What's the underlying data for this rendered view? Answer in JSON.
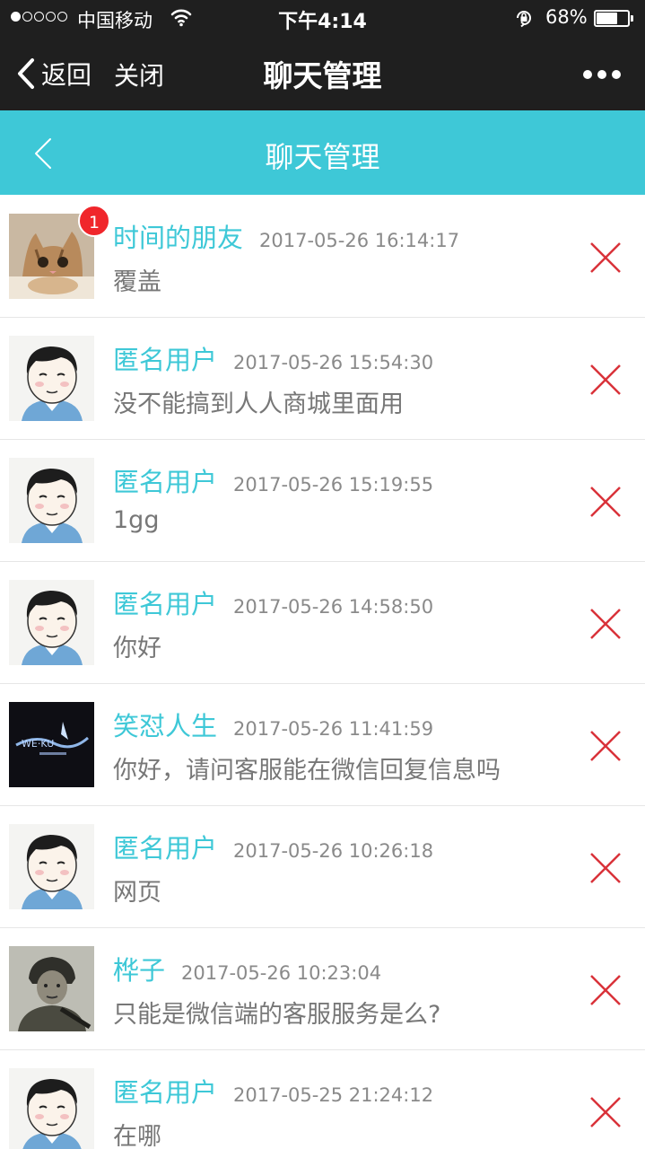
{
  "status_bar": {
    "carrier": "中国移动",
    "time": "下午4:14",
    "battery_percent": "68%",
    "battery_level": 0.68,
    "signal_bars": 1,
    "icons": [
      "signal-dots-icon",
      "wifi-icon",
      "rotation-lock-icon",
      "battery-icon"
    ]
  },
  "wechat_header": {
    "back_label": "返回",
    "close_label": "关闭",
    "title": "聊天管理",
    "more_icon": "more-dots-icon"
  },
  "app_header": {
    "title": "聊天管理",
    "back_icon": "chevron-left-icon"
  },
  "colors": {
    "accent": "#3ec8d7",
    "dark_bar": "#1f1f1f",
    "delete": "#d9323a",
    "badge": "#f0262b",
    "timestamp": "#8a8a8a",
    "message": "#777777"
  },
  "chats": [
    {
      "name": "时间的朋友",
      "time": "2017-05-26 16:14:17",
      "message": "覆盖",
      "avatar": "cat-photo",
      "badge": "1"
    },
    {
      "name": "匿名用户",
      "time": "2017-05-26 15:54:30",
      "message": "没不能搞到人人商城里面用",
      "avatar": "cartoon-boy"
    },
    {
      "name": "匿名用户",
      "time": "2017-05-26 15:19:55",
      "message": "1gg",
      "avatar": "cartoon-boy"
    },
    {
      "name": "匿名用户",
      "time": "2017-05-26 14:58:50",
      "message": "你好",
      "avatar": "cartoon-boy"
    },
    {
      "name": "笑怼人生",
      "time": "2017-05-26 11:41:59",
      "message": "你好，请问客服能在微信回复信息吗",
      "avatar": "dark-logo"
    },
    {
      "name": "匿名用户",
      "time": "2017-05-26 10:26:18",
      "message": "网页",
      "avatar": "cartoon-boy"
    },
    {
      "name": "桦子",
      "time": "2017-05-26 10:23:04",
      "message": "只能是微信端的客服服务是么?",
      "avatar": "soldier-photo"
    },
    {
      "name": "匿名用户",
      "time": "2017-05-25 21:24:12",
      "message": "在哪",
      "avatar": "cartoon-boy"
    }
  ]
}
